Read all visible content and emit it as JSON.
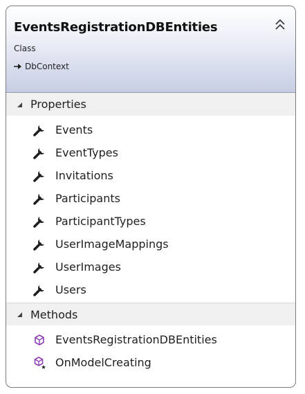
{
  "header": {
    "class_name": "EventsRegistrationDBEntities",
    "kind": "Class",
    "base_type": "DbContext"
  },
  "sections": {
    "properties": {
      "label": "Properties",
      "items": [
        {
          "label": "Events",
          "icon": "wrench-icon"
        },
        {
          "label": "EventTypes",
          "icon": "wrench-icon"
        },
        {
          "label": "Invitations",
          "icon": "wrench-icon"
        },
        {
          "label": "Participants",
          "icon": "wrench-icon"
        },
        {
          "label": "ParticipantTypes",
          "icon": "wrench-icon"
        },
        {
          "label": "UserImageMappings",
          "icon": "wrench-icon"
        },
        {
          "label": "UserImages",
          "icon": "wrench-icon"
        },
        {
          "label": "Users",
          "icon": "wrench-icon"
        }
      ]
    },
    "methods": {
      "label": "Methods",
      "items": [
        {
          "label": "EventsRegistrationDBEntities",
          "icon": "method-cube-icon"
        },
        {
          "label": "OnModelCreating",
          "icon": "protected-method-icon"
        }
      ]
    }
  },
  "colors": {
    "header_gradient_end": "#c7cde4",
    "method_icon": "#8b3fb3",
    "border": "#7a7a7a"
  }
}
